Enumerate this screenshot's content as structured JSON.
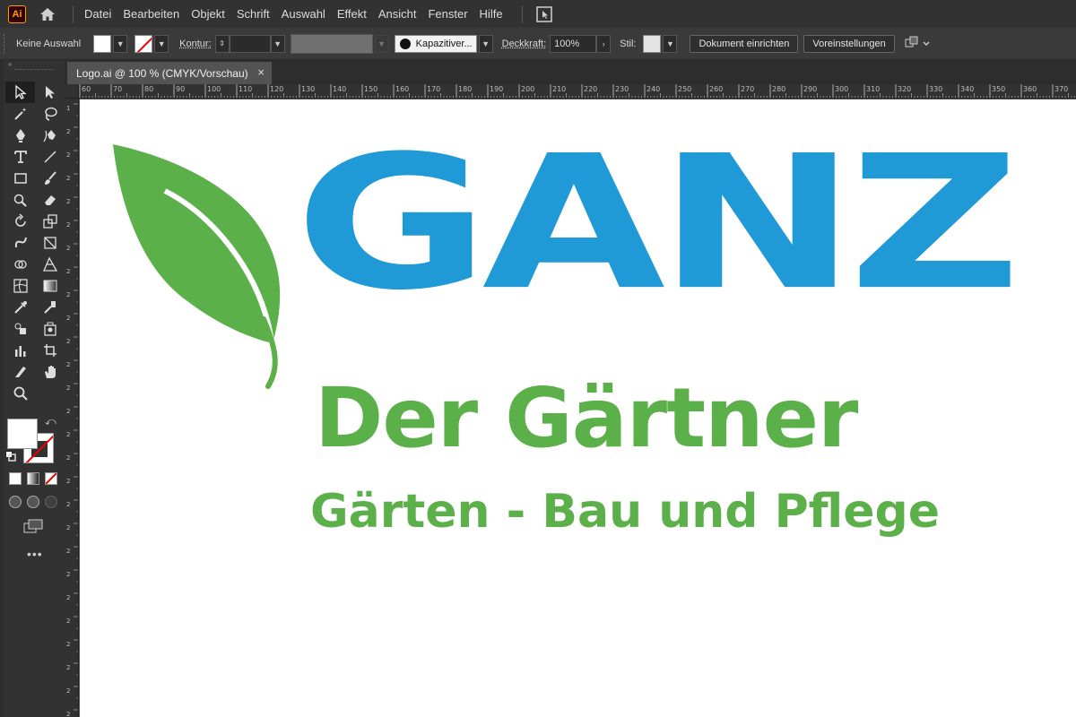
{
  "app": {
    "logo_text": "Ai",
    "menu": [
      "Datei",
      "Bearbeiten",
      "Objekt",
      "Schrift",
      "Auswahl",
      "Effekt",
      "Ansicht",
      "Fenster",
      "Hilfe"
    ]
  },
  "control_bar": {
    "selection_label": "Keine Auswahl",
    "stroke_label": "Kontur:",
    "stroke_value": "",
    "brush_label": "Kapazitiver...",
    "opacity_label": "Deckkraft:",
    "opacity_value": "100%",
    "style_label": "Stil:",
    "document_setup_button": "Dokument einrichten",
    "preferences_button": "Voreinstellungen"
  },
  "document": {
    "tab_title": "Logo.ai @ 100 % (CMYK/Vorschau)",
    "close_glyph": "×"
  },
  "ruler": {
    "horizontal_ticks": [
      "60",
      "70",
      "80",
      "90",
      "100",
      "110",
      "120",
      "130",
      "140",
      "150",
      "160",
      "170",
      "180",
      "190",
      "200",
      "210",
      "220",
      "230",
      "240",
      "250",
      "260",
      "270",
      "280",
      "290",
      "300",
      "310",
      "320",
      "330",
      "340",
      "350",
      "360",
      "370"
    ],
    "vertical_ticks": [
      "1",
      "2",
      "2",
      "2",
      "2",
      "2",
      "2",
      "2",
      "2",
      "2",
      "2",
      "2",
      "2",
      "2",
      "2",
      "2",
      "2",
      "2",
      "2",
      "2",
      "2",
      "2",
      "2",
      "2",
      "2",
      "2",
      "2"
    ]
  },
  "artwork": {
    "brand": "GANZ",
    "tagline": "Der Gärtner",
    "subline": "Gärten - Bau und Pflege",
    "colors": {
      "blue": "#1f9ad6",
      "green": "#5cb04a"
    }
  },
  "tools_panel": {
    "more_glyph": "•••"
  }
}
